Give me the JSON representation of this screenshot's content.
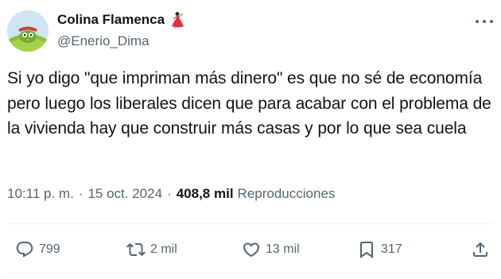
{
  "author": {
    "display_name": "Colina Flamenca",
    "handle": "@Enerio_Dima",
    "avatar_icon": "green-bird-avatar",
    "badge_icon": "flamenco-dancer-icon"
  },
  "tweet": {
    "text": "Si yo digo \"que impriman más dinero\" es que no sé de economía pero luego los liberales dicen que para acabar con el problema de la vivienda hay que construir más casas y por lo que sea cuela",
    "time": "10:11 p. m.",
    "separator": "·",
    "date": "15 oct. 2024",
    "views_count": "408,8 mil",
    "views_label": "Reproducciones"
  },
  "actions": {
    "replies": "799",
    "reposts": "2 mil",
    "likes": "13 mil",
    "bookmarks": "317"
  },
  "colors": {
    "text": "#0f1419",
    "secondary": "#536471",
    "divider": "#eff3f4"
  }
}
